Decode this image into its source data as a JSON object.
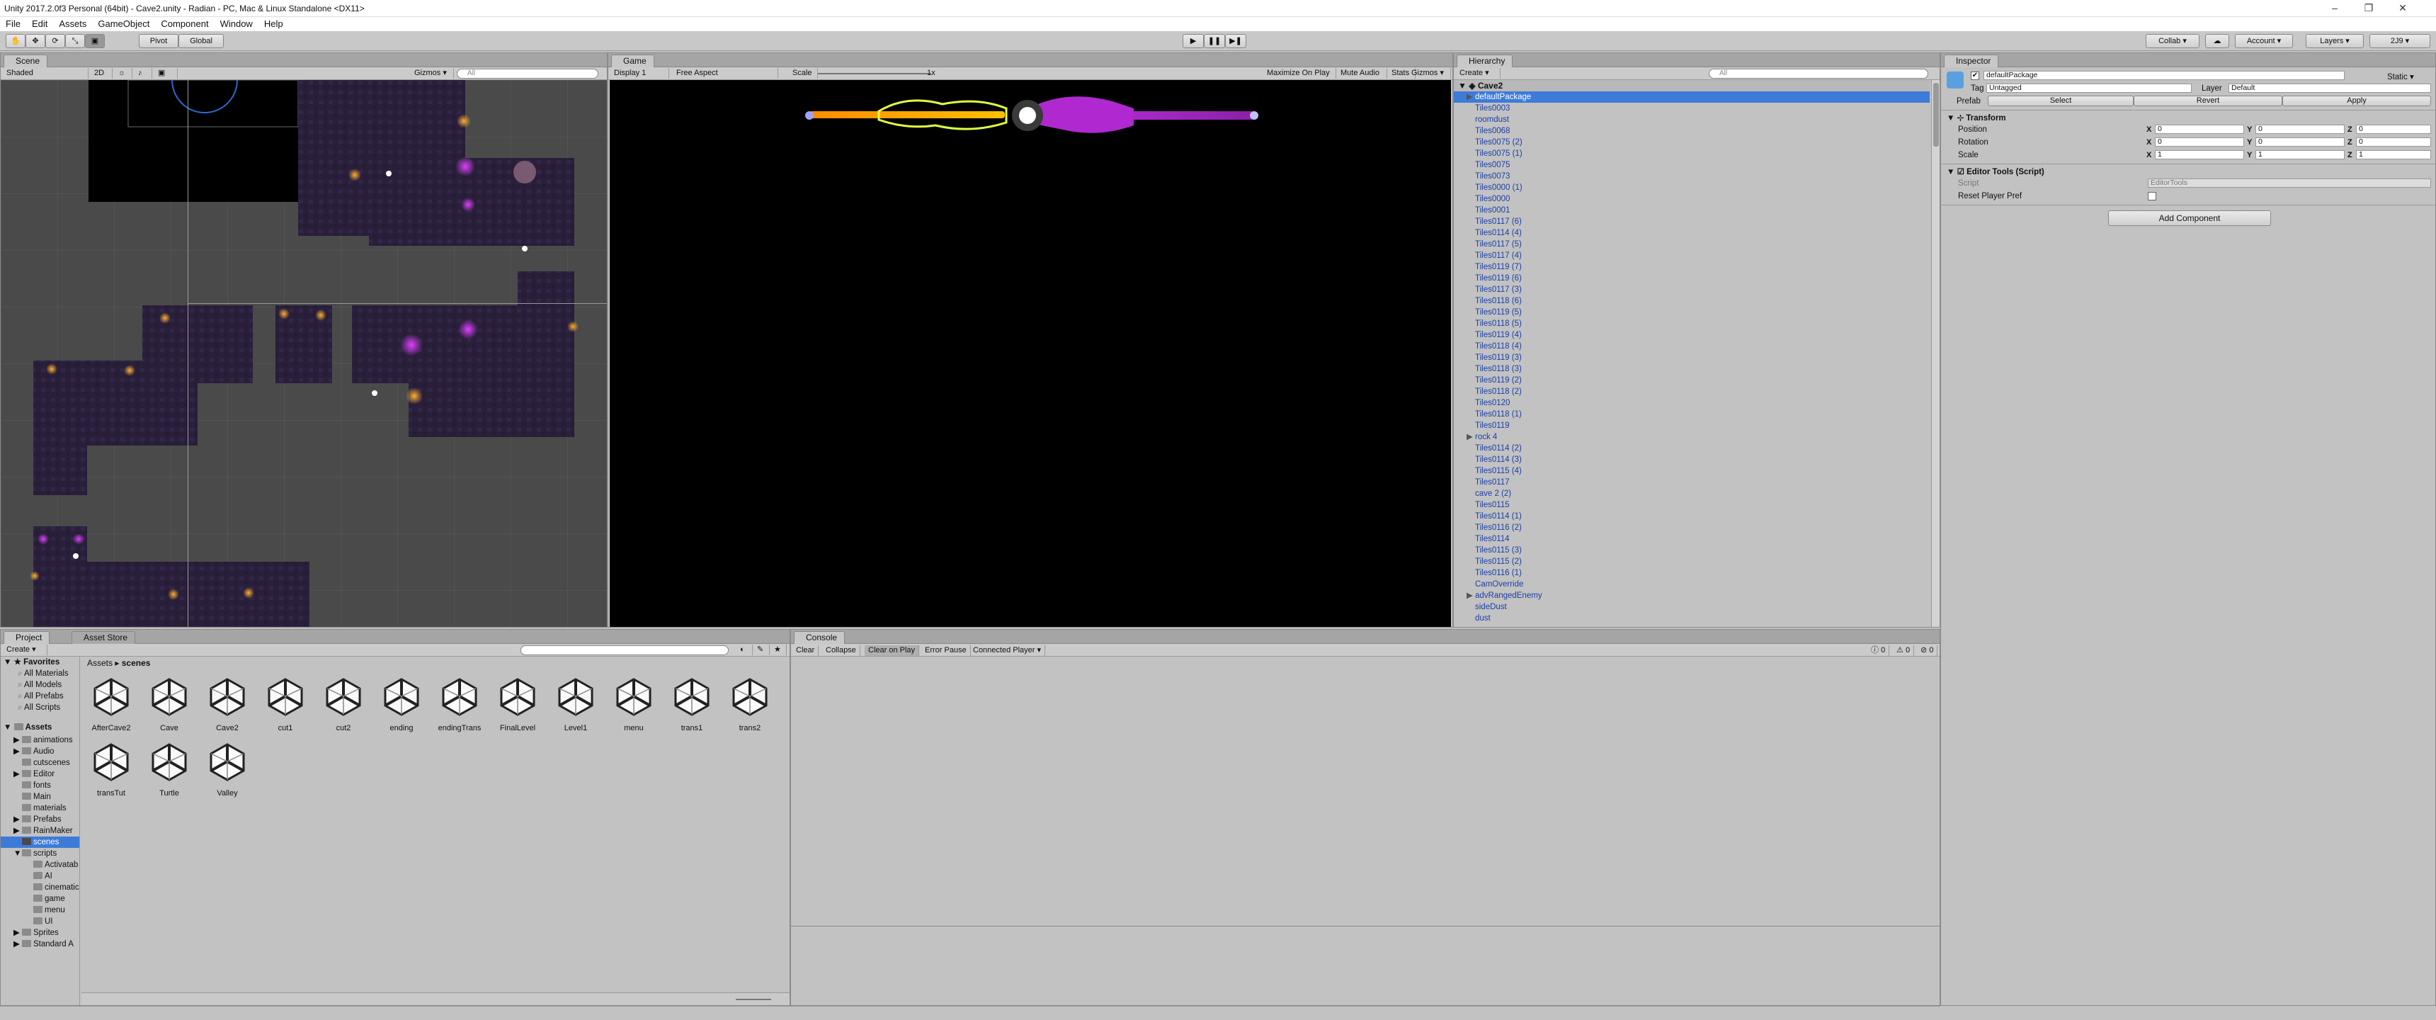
{
  "window": {
    "title": "Unity 2017.2.0f3 Personal (64bit) - Cave2.unity - Radian - PC, Mac & Linux Standalone <DX11>",
    "minimize": "–",
    "restore": "❐",
    "close": "✕"
  },
  "menu": [
    "File",
    "Edit",
    "Assets",
    "GameObject",
    "Component",
    "Window",
    "Help"
  ],
  "toolbar": {
    "pivot": "Pivot",
    "global": "Global",
    "play": "▶",
    "pause": "❚❚",
    "step": "▶❚",
    "collab": "Collab ▾",
    "cloud": "☁",
    "account": "Account ▾",
    "layers": "Layers ▾",
    "layout": "2J9 ▾"
  },
  "scene": {
    "tab": "Scene",
    "shading": "Shaded",
    "mode2d": "2D",
    "gizmos": "Gizmos ▾",
    "search": "All"
  },
  "game": {
    "tab": "Game",
    "display": "Display 1",
    "aspect": "Free Aspect",
    "scale_label": "Scale",
    "scale_value": "1x",
    "maximize": "Maximize On Play",
    "mute": "Mute Audio",
    "stats": "Stats",
    "gizmos": "Gizmos ▾"
  },
  "hierarchy": {
    "tab": "Hierarchy",
    "create": "Create ▾",
    "search": "All",
    "scene": "Cave2",
    "items": [
      {
        "label": "defaultPackage",
        "selected": true,
        "foldout": true
      },
      {
        "label": "Tiles0003"
      },
      {
        "label": "roomdust"
      },
      {
        "label": "Tiles0068"
      },
      {
        "label": "Tiles0075 (2)"
      },
      {
        "label": "Tiles0075 (1)"
      },
      {
        "label": "Tiles0075"
      },
      {
        "label": "Tiles0073"
      },
      {
        "label": "Tiles0000 (1)"
      },
      {
        "label": "Tiles0000"
      },
      {
        "label": "Tiles0001"
      },
      {
        "label": "Tiles0117 (6)"
      },
      {
        "label": "Tiles0114 (4)"
      },
      {
        "label": "Tiles0117 (5)"
      },
      {
        "label": "Tiles0117 (4)"
      },
      {
        "label": "Tiles0119 (7)"
      },
      {
        "label": "Tiles0119 (6)"
      },
      {
        "label": "Tiles0117 (3)"
      },
      {
        "label": "Tiles0118 (6)"
      },
      {
        "label": "Tiles0119 (5)"
      },
      {
        "label": "Tiles0118 (5)"
      },
      {
        "label": "Tiles0119 (4)"
      },
      {
        "label": "Tiles0118 (4)"
      },
      {
        "label": "Tiles0119 (3)"
      },
      {
        "label": "Tiles0118 (3)"
      },
      {
        "label": "Tiles0119 (2)"
      },
      {
        "label": "Tiles0118 (2)"
      },
      {
        "label": "Tiles0120"
      },
      {
        "label": "Tiles0118 (1)"
      },
      {
        "label": "Tiles0119"
      },
      {
        "label": "rock 4",
        "foldout": true
      },
      {
        "label": "Tiles0114 (2)"
      },
      {
        "label": "Tiles0114 (3)"
      },
      {
        "label": "Tiles0115 (4)"
      },
      {
        "label": "Tiles0117"
      },
      {
        "label": "cave 2 (2)"
      },
      {
        "label": "Tiles0115"
      },
      {
        "label": "Tiles0114 (1)"
      },
      {
        "label": "Tiles0116 (2)"
      },
      {
        "label": "Tiles0114"
      },
      {
        "label": "Tiles0115 (3)"
      },
      {
        "label": "Tiles0115 (2)"
      },
      {
        "label": "Tiles0116 (1)"
      },
      {
        "label": "CamOverride"
      },
      {
        "label": "advRangedEnemy",
        "foldout": true
      },
      {
        "label": "sideDust"
      },
      {
        "label": "dust"
      }
    ]
  },
  "inspector": {
    "tab": "Inspector",
    "object_name": "defaultPackage",
    "static_label": "Static ▾",
    "tag_label": "Tag",
    "tag_value": "Untagged",
    "layer_label": "Layer",
    "layer_value": "Default",
    "prefab_label": "Prefab",
    "prefab_select": "Select",
    "prefab_revert": "Revert",
    "prefab_apply": "Apply",
    "transform_title": "Transform",
    "position_label": "Position",
    "rotation_label": "Rotation",
    "scale_label": "Scale",
    "position": {
      "x": "0",
      "y": "0",
      "z": "0"
    },
    "rotation": {
      "x": "0",
      "y": "0",
      "z": "0"
    },
    "scale": {
      "x": "1",
      "y": "1",
      "z": "1"
    },
    "script_title": "Editor Tools (Script)",
    "script_label": "Script",
    "script_value": "EditorTools",
    "reset_label": "Reset Player Pref",
    "add_component": "Add Component"
  },
  "project": {
    "tab": "Project",
    "tab2": "Asset Store",
    "create": "Create ▾",
    "breadcrumb_root": "Assets",
    "breadcrumb_current": "scenes",
    "favorites_title": "Favorites",
    "favorites": [
      "All Materials",
      "All Models",
      "All Prefabs",
      "All Scripts"
    ],
    "assets_title": "Assets",
    "folders": [
      {
        "label": "animations",
        "depth": 1,
        "fold": true
      },
      {
        "label": "Audio",
        "depth": 1,
        "fold": true
      },
      {
        "label": "cutscenes",
        "depth": 1
      },
      {
        "label": "Editor",
        "depth": 1,
        "fold": true
      },
      {
        "label": "fonts",
        "depth": 1
      },
      {
        "label": "Main",
        "depth": 1
      },
      {
        "label": "materials",
        "depth": 1
      },
      {
        "label": "Prefabs",
        "depth": 1,
        "fold": true
      },
      {
        "label": "RainMaker",
        "depth": 1,
        "fold": true
      },
      {
        "label": "scenes",
        "depth": 1,
        "selected": true
      },
      {
        "label": "scripts",
        "depth": 1,
        "fold": true,
        "open": true
      },
      {
        "label": "Activatab",
        "depth": 2
      },
      {
        "label": "AI",
        "depth": 2
      },
      {
        "label": "cinematic",
        "depth": 2
      },
      {
        "label": "game",
        "depth": 2
      },
      {
        "label": "menu",
        "depth": 2
      },
      {
        "label": "UI",
        "depth": 2
      },
      {
        "label": "Sprites",
        "depth": 1,
        "fold": true
      },
      {
        "label": "Standard A",
        "depth": 1,
        "fold": true
      }
    ],
    "files": [
      "AfterCave2",
      "Cave",
      "Cave2",
      "cut1",
      "cut2",
      "ending",
      "endingTrans",
      "FinalLevel",
      "Level1",
      "menu",
      "trans1",
      "trans2",
      "transTut",
      "Turtle",
      "Valley"
    ]
  },
  "console": {
    "tab": "Console",
    "buttons": [
      "Clear",
      "Collapse",
      "Clear on Play",
      "Error Pause",
      "Connected Player ▾"
    ],
    "count_info": "0",
    "count_warn": "0",
    "count_error": "0"
  }
}
